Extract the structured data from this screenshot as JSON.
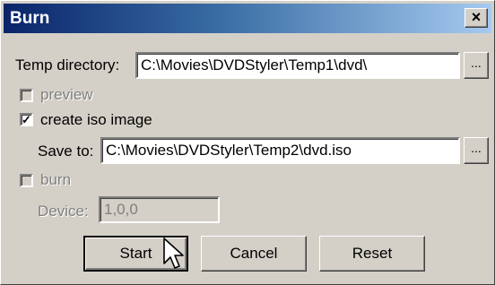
{
  "window": {
    "title": "Burn",
    "close_label": "×"
  },
  "temp_directory": {
    "label": "Temp directory:",
    "value": "C:\\Movies\\DVDStyler\\Temp1\\dvd\\",
    "browse_label": "..."
  },
  "preview": {
    "label": "preview",
    "checked": false,
    "enabled": false
  },
  "create_iso": {
    "label": "create iso image",
    "checked": true,
    "check_glyph": "✓"
  },
  "save_to": {
    "label": "Save to:",
    "value": "C:\\Movies\\DVDStyler\\Temp2\\dvd.iso",
    "browse_label": "..."
  },
  "burn": {
    "label": "burn",
    "checked": false,
    "enabled": false
  },
  "device": {
    "label": "Device:",
    "value": "1,0,0",
    "enabled": false
  },
  "buttons": {
    "start": "Start",
    "cancel": "Cancel",
    "reset": "Reset"
  },
  "cursor": {
    "icon": "arrow-pointer-icon"
  }
}
